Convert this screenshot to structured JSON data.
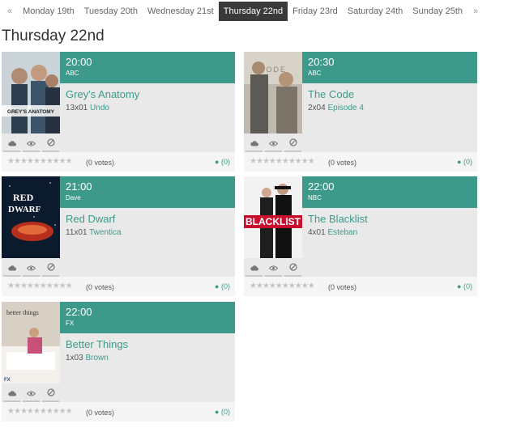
{
  "nav": {
    "prev": "«",
    "next": "»",
    "days": [
      "Monday 19th",
      "Tuesday 20th",
      "Wednesday 21st",
      "Thursday 22nd",
      "Friday 23rd",
      "Saturday 24th",
      "Sunday 25th"
    ],
    "active_index": 3
  },
  "page_title": "Thursday 22nd",
  "shows": [
    {
      "time": "20:00",
      "network": "ABC",
      "title": "Grey's Anatomy",
      "ep_num": "13x01",
      "ep_name": "Undo",
      "votes": "(0 votes)",
      "comments": "(0)",
      "poster_text": "GREY'S ANATOMY"
    },
    {
      "time": "20:30",
      "network": "ABC",
      "title": "The Code",
      "ep_num": "2x04",
      "ep_name": "Episode 4",
      "votes": "(0 votes)",
      "comments": "(0)",
      "poster_text": "CODE"
    },
    {
      "time": "21:00",
      "network": "Dave",
      "title": "Red Dwarf",
      "ep_num": "11x01",
      "ep_name": "Twentica",
      "votes": "(0 votes)",
      "comments": "(0)",
      "poster_text": "RED DWARF"
    },
    {
      "time": "22:00",
      "network": "NBC",
      "title": "The Blacklist",
      "ep_num": "4x01",
      "ep_name": "Esteban",
      "votes": "(0 votes)",
      "comments": "(0)",
      "poster_text": "BLACKLIST"
    },
    {
      "time": "22:00",
      "network": "FX",
      "title": "Better Things",
      "ep_num": "1x03",
      "ep_name": "Brown",
      "votes": "(0 votes)",
      "comments": "(0)",
      "poster_text": "better things"
    }
  ],
  "colors": {
    "accent": "#3d9a8a",
    "active_tab": "#3a3a3a",
    "card_body": "#e9e9e9"
  },
  "icons": {
    "action_1": "cloud-icon",
    "action_2": "eye-icon",
    "action_3": "ban-icon",
    "comment": "comment-icon",
    "star": "star-icon"
  }
}
